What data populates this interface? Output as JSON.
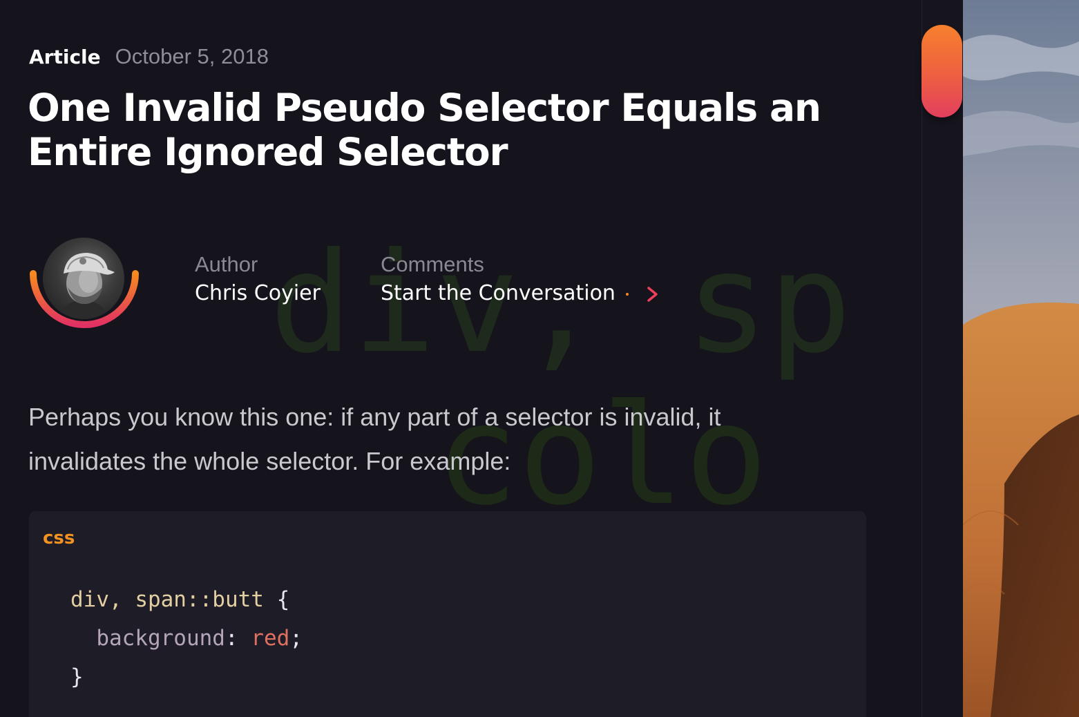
{
  "article": {
    "type_label": "Article",
    "date": "October 5, 2018",
    "title": "One Invalid Pseudo Selector Equals an Entire Ignored Selector"
  },
  "author": {
    "label": "Author",
    "name": "Chris Coyier",
    "avatar_icon": "author-photo"
  },
  "comments": {
    "label": "Comments",
    "link_text": "Start the Conversation",
    "icon": "arrow-right-icon"
  },
  "body": {
    "intro": "Perhaps you know this one: if any part of a selector is invalid, it invalidates the whole selector. For example:"
  },
  "code": {
    "language": "css",
    "selector": "div, span::butt",
    "open_brace": "{",
    "property": "background",
    "colon": ":",
    "value": "red",
    "semicolon": ";",
    "close_brace": "}"
  },
  "watermark": {
    "line1": "div, sp",
    "line2": "colo"
  },
  "colors": {
    "background": "#15141d",
    "accent_orange": "#f39221",
    "accent_pink": "#e23f5e",
    "code_background": "#1e1c27"
  }
}
